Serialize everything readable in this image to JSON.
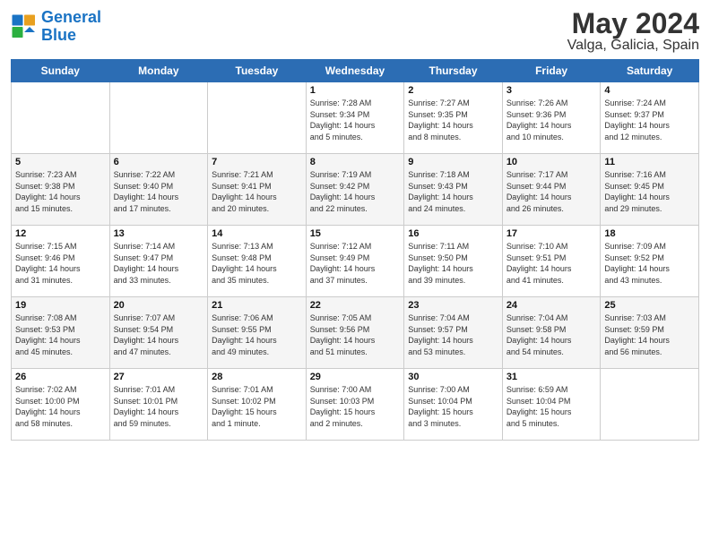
{
  "logo": {
    "line1": "General",
    "line2": "Blue"
  },
  "title": "May 2024",
  "location": "Valga, Galicia, Spain",
  "days_of_week": [
    "Sunday",
    "Monday",
    "Tuesday",
    "Wednesday",
    "Thursday",
    "Friday",
    "Saturday"
  ],
  "weeks": [
    [
      {
        "day": "",
        "info": ""
      },
      {
        "day": "",
        "info": ""
      },
      {
        "day": "",
        "info": ""
      },
      {
        "day": "1",
        "info": "Sunrise: 7:28 AM\nSunset: 9:34 PM\nDaylight: 14 hours\nand 5 minutes."
      },
      {
        "day": "2",
        "info": "Sunrise: 7:27 AM\nSunset: 9:35 PM\nDaylight: 14 hours\nand 8 minutes."
      },
      {
        "day": "3",
        "info": "Sunrise: 7:26 AM\nSunset: 9:36 PM\nDaylight: 14 hours\nand 10 minutes."
      },
      {
        "day": "4",
        "info": "Sunrise: 7:24 AM\nSunset: 9:37 PM\nDaylight: 14 hours\nand 12 minutes."
      }
    ],
    [
      {
        "day": "5",
        "info": "Sunrise: 7:23 AM\nSunset: 9:38 PM\nDaylight: 14 hours\nand 15 minutes."
      },
      {
        "day": "6",
        "info": "Sunrise: 7:22 AM\nSunset: 9:40 PM\nDaylight: 14 hours\nand 17 minutes."
      },
      {
        "day": "7",
        "info": "Sunrise: 7:21 AM\nSunset: 9:41 PM\nDaylight: 14 hours\nand 20 minutes."
      },
      {
        "day": "8",
        "info": "Sunrise: 7:19 AM\nSunset: 9:42 PM\nDaylight: 14 hours\nand 22 minutes."
      },
      {
        "day": "9",
        "info": "Sunrise: 7:18 AM\nSunset: 9:43 PM\nDaylight: 14 hours\nand 24 minutes."
      },
      {
        "day": "10",
        "info": "Sunrise: 7:17 AM\nSunset: 9:44 PM\nDaylight: 14 hours\nand 26 minutes."
      },
      {
        "day": "11",
        "info": "Sunrise: 7:16 AM\nSunset: 9:45 PM\nDaylight: 14 hours\nand 29 minutes."
      }
    ],
    [
      {
        "day": "12",
        "info": "Sunrise: 7:15 AM\nSunset: 9:46 PM\nDaylight: 14 hours\nand 31 minutes."
      },
      {
        "day": "13",
        "info": "Sunrise: 7:14 AM\nSunset: 9:47 PM\nDaylight: 14 hours\nand 33 minutes."
      },
      {
        "day": "14",
        "info": "Sunrise: 7:13 AM\nSunset: 9:48 PM\nDaylight: 14 hours\nand 35 minutes."
      },
      {
        "day": "15",
        "info": "Sunrise: 7:12 AM\nSunset: 9:49 PM\nDaylight: 14 hours\nand 37 minutes."
      },
      {
        "day": "16",
        "info": "Sunrise: 7:11 AM\nSunset: 9:50 PM\nDaylight: 14 hours\nand 39 minutes."
      },
      {
        "day": "17",
        "info": "Sunrise: 7:10 AM\nSunset: 9:51 PM\nDaylight: 14 hours\nand 41 minutes."
      },
      {
        "day": "18",
        "info": "Sunrise: 7:09 AM\nSunset: 9:52 PM\nDaylight: 14 hours\nand 43 minutes."
      }
    ],
    [
      {
        "day": "19",
        "info": "Sunrise: 7:08 AM\nSunset: 9:53 PM\nDaylight: 14 hours\nand 45 minutes."
      },
      {
        "day": "20",
        "info": "Sunrise: 7:07 AM\nSunset: 9:54 PM\nDaylight: 14 hours\nand 47 minutes."
      },
      {
        "day": "21",
        "info": "Sunrise: 7:06 AM\nSunset: 9:55 PM\nDaylight: 14 hours\nand 49 minutes."
      },
      {
        "day": "22",
        "info": "Sunrise: 7:05 AM\nSunset: 9:56 PM\nDaylight: 14 hours\nand 51 minutes."
      },
      {
        "day": "23",
        "info": "Sunrise: 7:04 AM\nSunset: 9:57 PM\nDaylight: 14 hours\nand 53 minutes."
      },
      {
        "day": "24",
        "info": "Sunrise: 7:04 AM\nSunset: 9:58 PM\nDaylight: 14 hours\nand 54 minutes."
      },
      {
        "day": "25",
        "info": "Sunrise: 7:03 AM\nSunset: 9:59 PM\nDaylight: 14 hours\nand 56 minutes."
      }
    ],
    [
      {
        "day": "26",
        "info": "Sunrise: 7:02 AM\nSunset: 10:00 PM\nDaylight: 14 hours\nand 58 minutes."
      },
      {
        "day": "27",
        "info": "Sunrise: 7:01 AM\nSunset: 10:01 PM\nDaylight: 14 hours\nand 59 minutes."
      },
      {
        "day": "28",
        "info": "Sunrise: 7:01 AM\nSunset: 10:02 PM\nDaylight: 15 hours\nand 1 minute."
      },
      {
        "day": "29",
        "info": "Sunrise: 7:00 AM\nSunset: 10:03 PM\nDaylight: 15 hours\nand 2 minutes."
      },
      {
        "day": "30",
        "info": "Sunrise: 7:00 AM\nSunset: 10:04 PM\nDaylight: 15 hours\nand 3 minutes."
      },
      {
        "day": "31",
        "info": "Sunrise: 6:59 AM\nSunset: 10:04 PM\nDaylight: 15 hours\nand 5 minutes."
      },
      {
        "day": "",
        "info": ""
      }
    ]
  ]
}
